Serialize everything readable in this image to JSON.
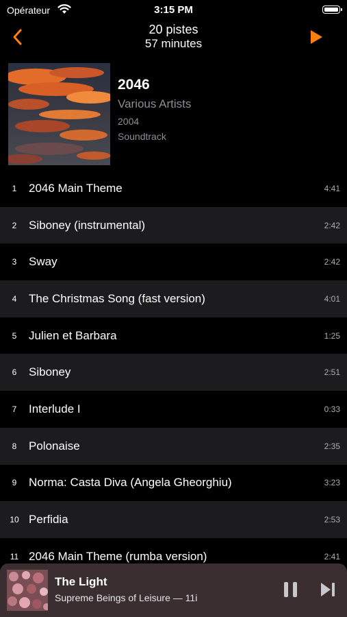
{
  "status": {
    "carrier": "Opérateur",
    "time": "3:15 PM"
  },
  "nav": {
    "line1": "20 pistes",
    "line2": "57 minutes",
    "accent": "#ff7f0e"
  },
  "album": {
    "title": "2046",
    "artist": "Various Artists",
    "year": "2004",
    "genre": "Soundtrack"
  },
  "tracks": [
    {
      "num": "1",
      "title": "2046 Main Theme",
      "duration": "4:41"
    },
    {
      "num": "2",
      "title": "Siboney (instrumental)",
      "duration": "2:42"
    },
    {
      "num": "3",
      "title": "Sway",
      "duration": "2:42"
    },
    {
      "num": "4",
      "title": "The Christmas Song (fast version)",
      "duration": "4:01"
    },
    {
      "num": "5",
      "title": "Julien et Barbara",
      "duration": "1:25"
    },
    {
      "num": "6",
      "title": "Siboney",
      "duration": "2:51"
    },
    {
      "num": "7",
      "title": "Interlude I",
      "duration": "0:33"
    },
    {
      "num": "8",
      "title": "Polonaise",
      "duration": "2:35"
    },
    {
      "num": "9",
      "title": "Norma: Casta Diva (Angela Gheorghiu)",
      "duration": "3:23"
    },
    {
      "num": "10",
      "title": "Perfidia",
      "duration": "2:53"
    },
    {
      "num": "11",
      "title": "2046 Main Theme (rumba version)",
      "duration": "2:41"
    }
  ],
  "now_playing": {
    "title": "The Light",
    "subtitle": "Supreme Beings of Leisure — 11i"
  }
}
